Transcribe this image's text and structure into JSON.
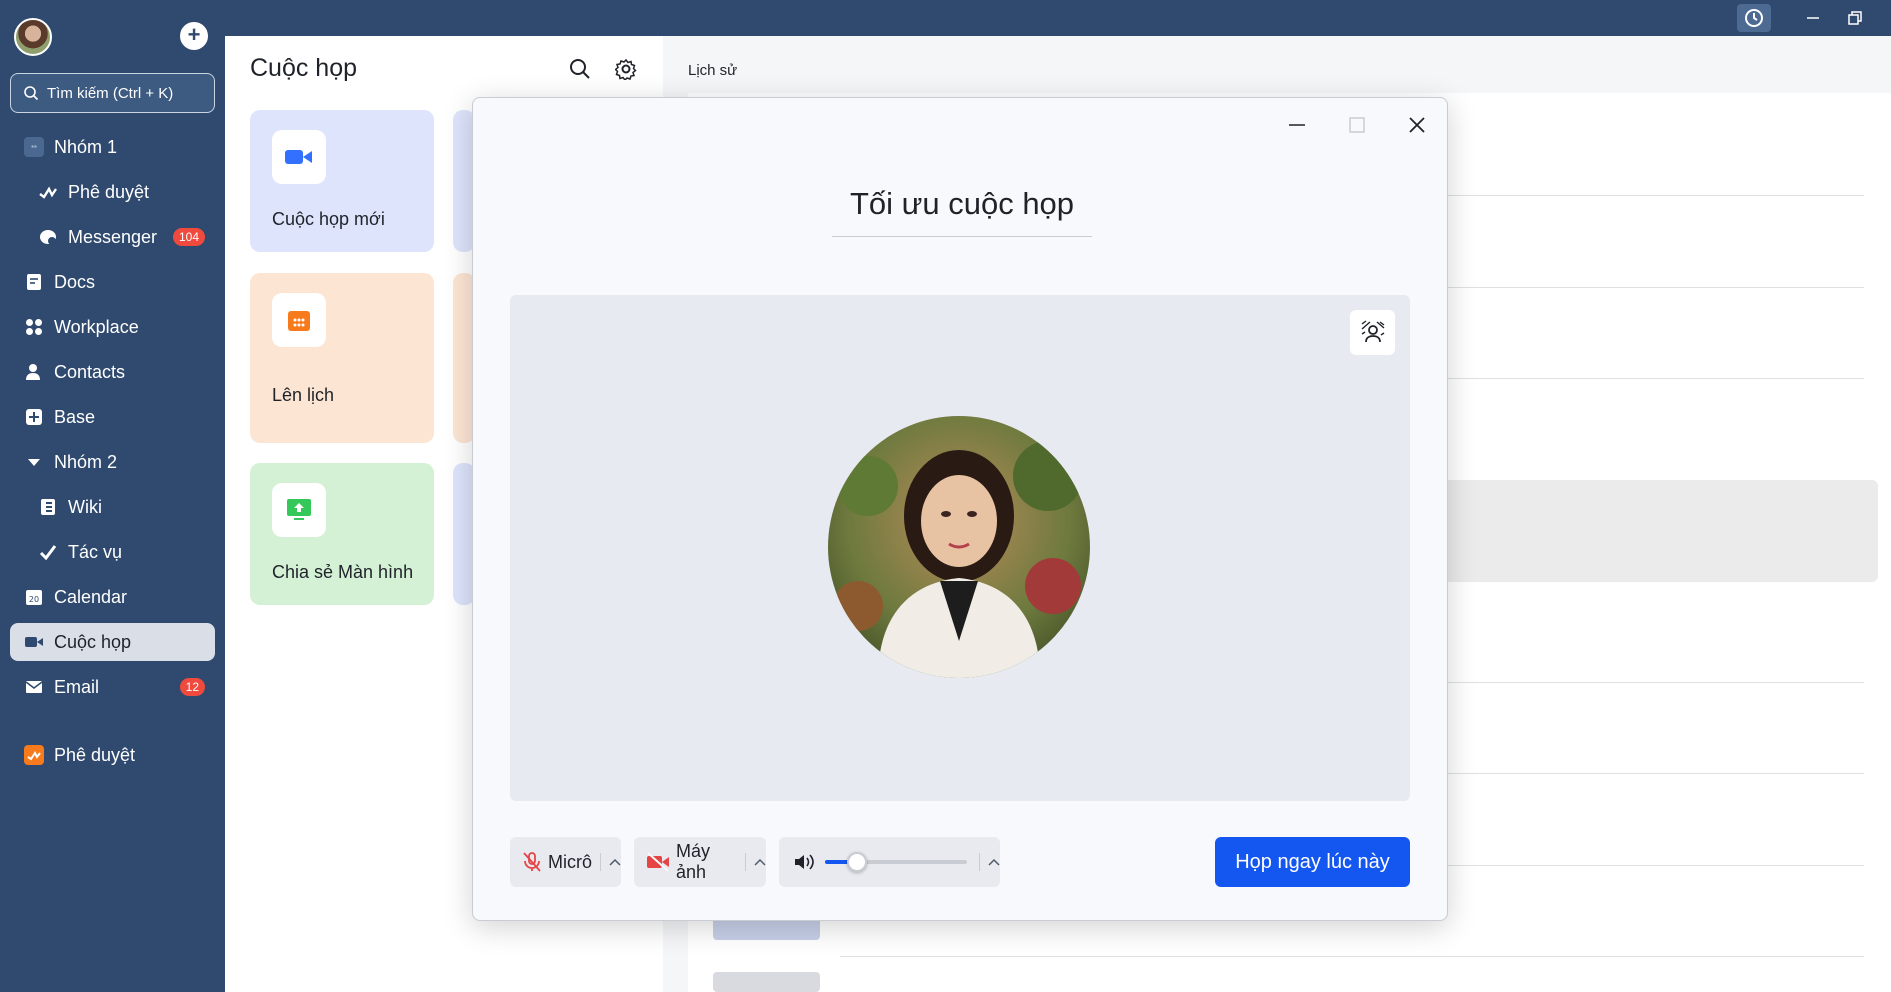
{
  "sidebar": {
    "search_placeholder": "Tìm kiếm (Ctrl + K)",
    "items": [
      {
        "label": "Nhóm 1"
      },
      {
        "label": "Phê duyệt"
      },
      {
        "label": "Messenger",
        "badge": "104"
      },
      {
        "label": "Docs"
      },
      {
        "label": "Workplace"
      },
      {
        "label": "Contacts"
      },
      {
        "label": "Base"
      },
      {
        "label": "Nhóm 2"
      },
      {
        "label": "Wiki"
      },
      {
        "label": "Tác vụ"
      },
      {
        "label": "Calendar"
      },
      {
        "label": "Cuộc họp"
      },
      {
        "label": "Email",
        "badge": "12"
      },
      {
        "label": "Phê duyệt"
      }
    ]
  },
  "main": {
    "title": "Cuộc họp",
    "history_label": "Lịch sử",
    "cards": [
      {
        "label": "Cuộc họp mới",
        "color": "#dde4fb",
        "icon_color": "#3370ff"
      },
      {
        "label": "Lên lịch",
        "color": "#fde5d3",
        "icon_color": "#f77b1d"
      },
      {
        "label": "Chia sẻ Màn hình",
        "color": "#d5f1d5",
        "icon_color": "#34c759"
      }
    ]
  },
  "modal": {
    "title": "Tối ưu cuộc họp",
    "mic_label": "Micrô",
    "camera_label": "Máy ảnh",
    "join_label": "Họp ngay lúc này",
    "volume_level": 0.18,
    "accent": "#1456f0"
  }
}
